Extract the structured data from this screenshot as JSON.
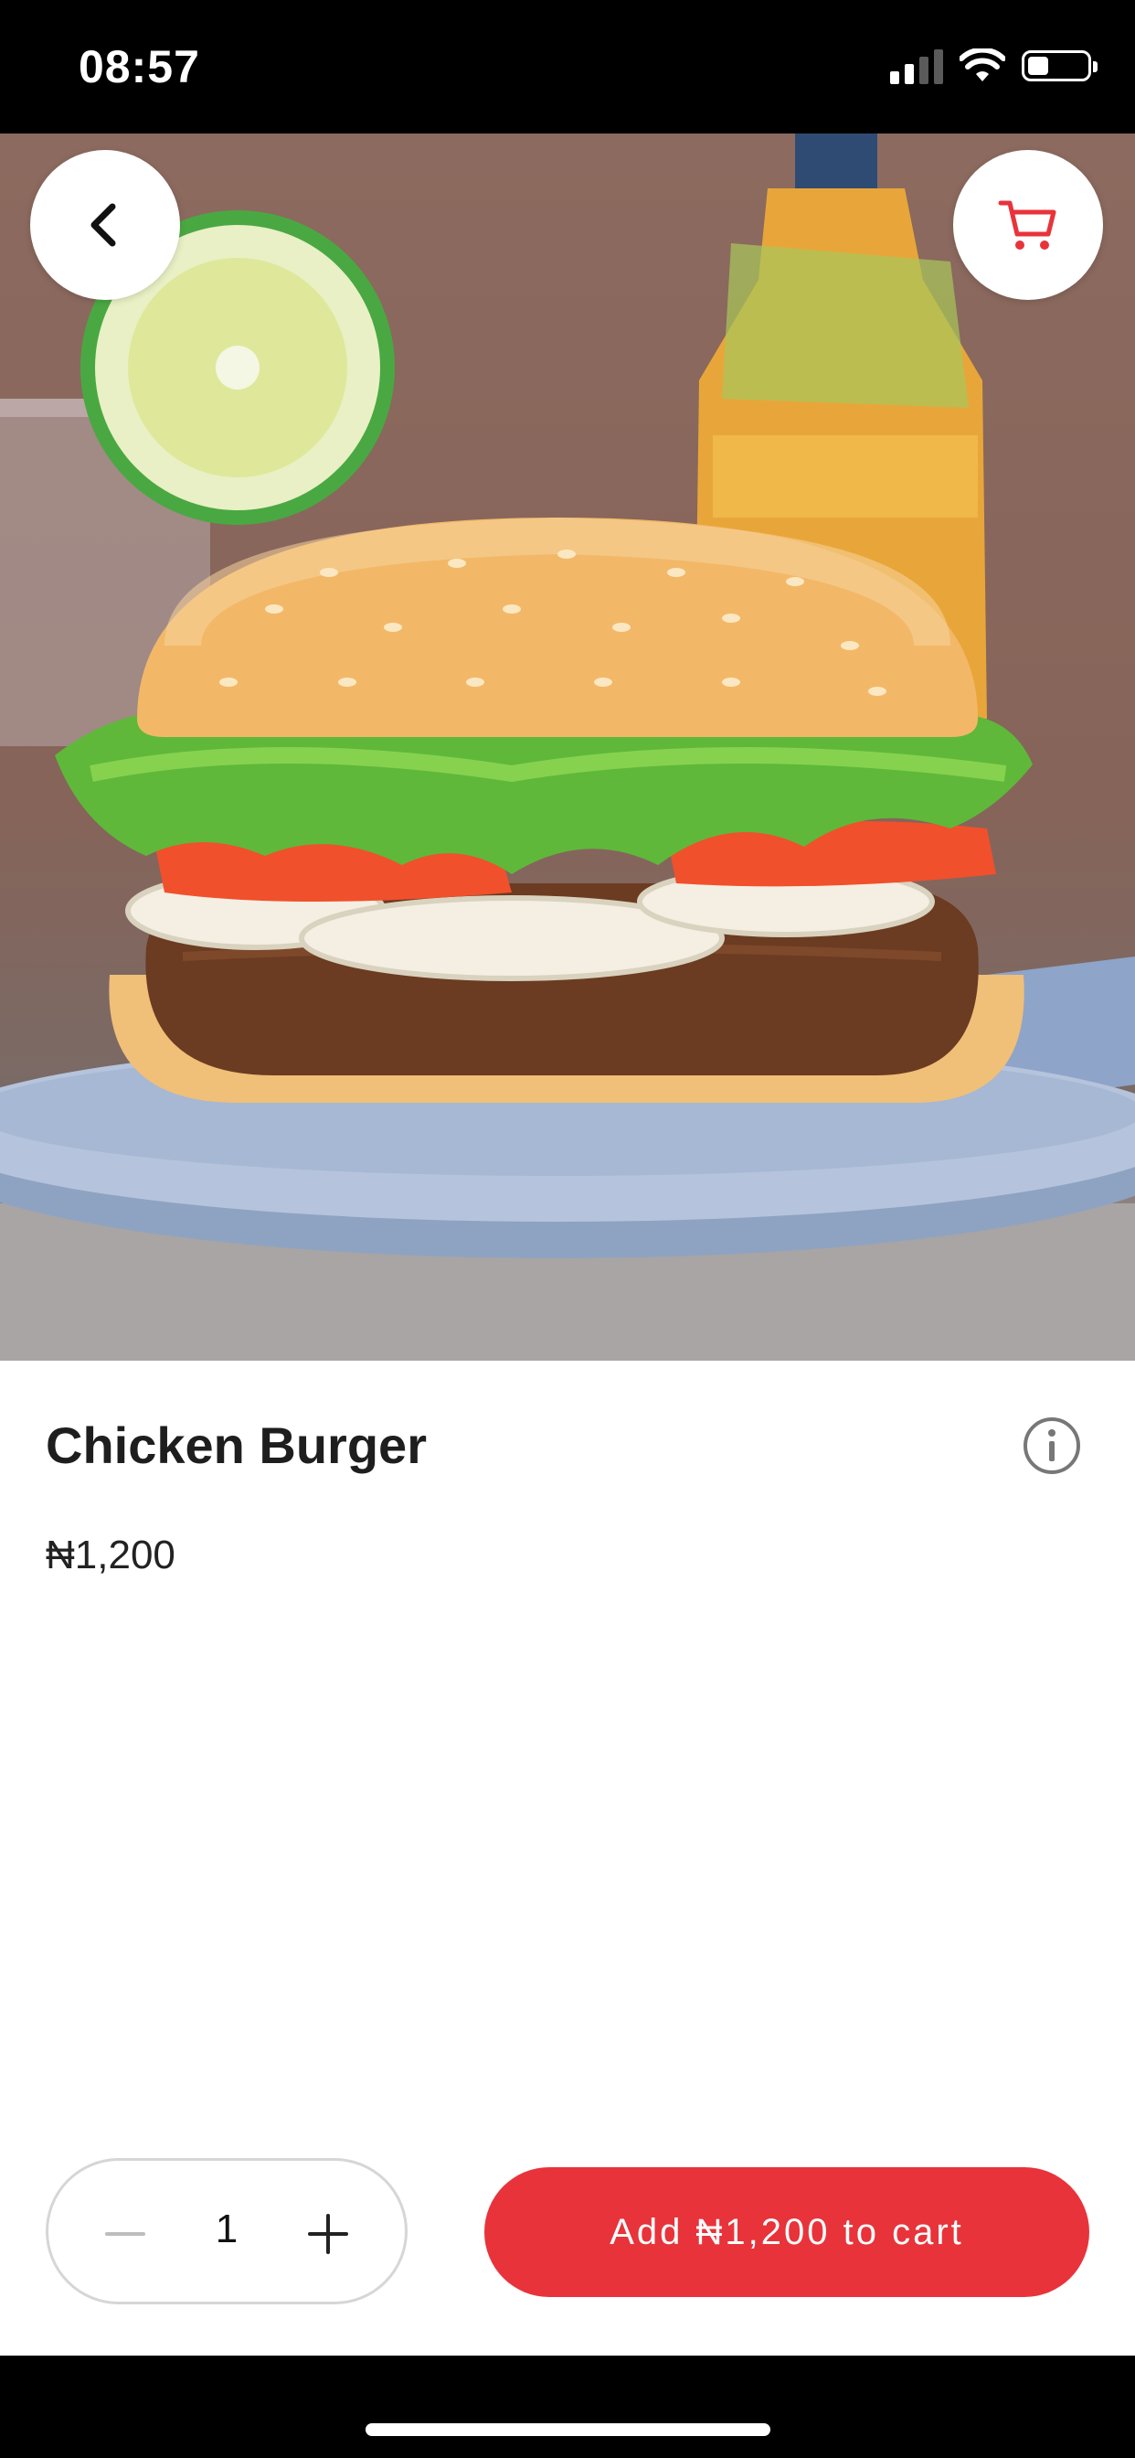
{
  "status_bar": {
    "time": "08:57"
  },
  "product": {
    "name": "Chicken Burger",
    "price": "₦1,200",
    "image_description": "burger-photo"
  },
  "controls": {
    "back_icon": "chevron-left-icon",
    "cart_icon": "cart-icon",
    "info_icon": "info-icon"
  },
  "quantity": {
    "value": "1",
    "minus_icon": "minus-icon",
    "plus_icon": "plus-icon"
  },
  "add_to_cart": {
    "label": "Add ₦1,200 to cart"
  },
  "colors": {
    "accent": "#e8333a",
    "text": "#1e1e1e",
    "border": "#d6d6d6"
  }
}
